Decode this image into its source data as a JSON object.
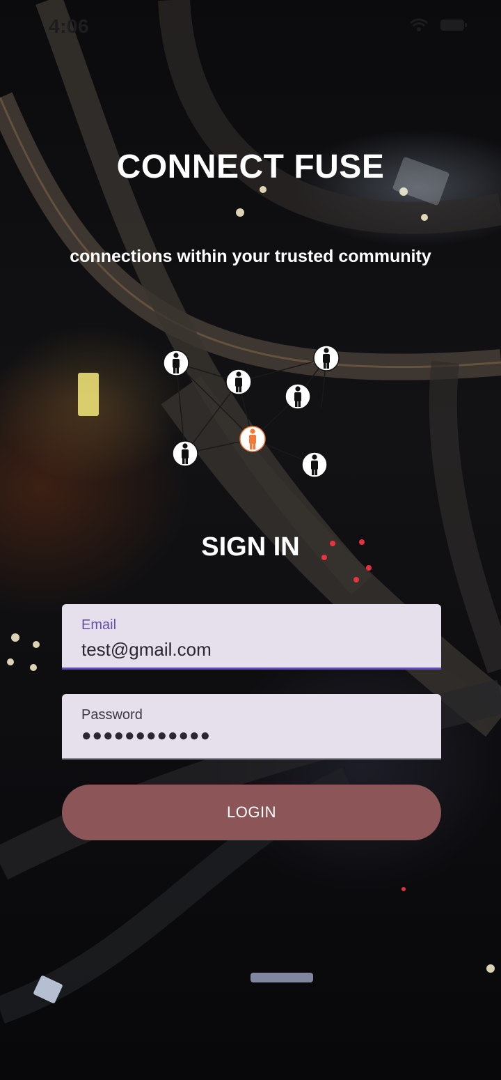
{
  "status_bar": {
    "time": "4:06",
    "icons": [
      "wifi-icon",
      "battery-icon"
    ]
  },
  "header": {
    "title": "CONNECT FUSE",
    "tagline": "connections within your trusted community"
  },
  "network_graphic": {
    "nodes": [
      "person-icon",
      "person-icon",
      "person-icon",
      "person-icon",
      "person-icon",
      "person-icon",
      "person-icon"
    ],
    "highlight_color": "#f07a3a"
  },
  "signin": {
    "heading": "SIGN IN",
    "email": {
      "label": "Email",
      "value": "test@gmail.com"
    },
    "password": {
      "label": "Password",
      "masked_value": "●●●●●●●●●●●●"
    },
    "login_label": "LOGIN"
  },
  "colors": {
    "accent": "#6550a8",
    "button": "#8c5658",
    "field_bg": "#e6e0ec"
  }
}
